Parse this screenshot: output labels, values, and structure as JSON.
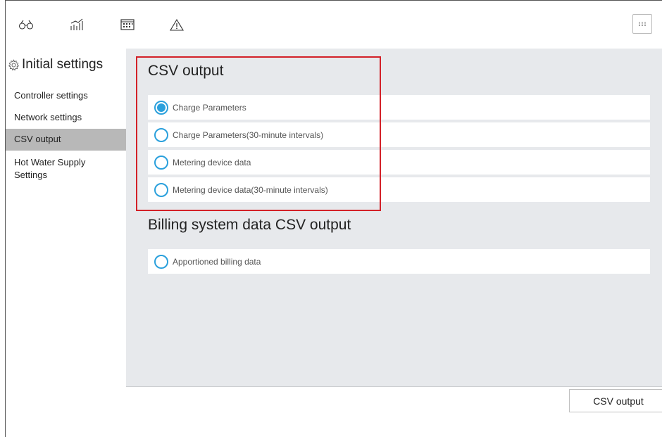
{
  "toolbar": {
    "icons": [
      "binoculars-icon",
      "chart-icon",
      "calendar-icon",
      "warning-icon"
    ],
    "menu_icon": "menu-icon"
  },
  "sidebar": {
    "title": "Initial settings",
    "title_icon": "gear-icon",
    "items": [
      {
        "label": "Controller settings",
        "active": false
      },
      {
        "label": "Network settings",
        "active": false
      },
      {
        "label": "CSV output",
        "active": true
      },
      {
        "label": "Hot Water Supply Settings",
        "active": false
      }
    ]
  },
  "main": {
    "csv_section": {
      "title": "CSV output",
      "options": [
        {
          "label": "Charge Parameters",
          "selected": true
        },
        {
          "label": "Charge Parameters(30-minute intervals)",
          "selected": false
        },
        {
          "label": "Metering device data",
          "selected": false
        },
        {
          "label": "Metering device data(30-minute intervals)",
          "selected": false
        }
      ]
    },
    "billing_section": {
      "title": "Billing system data CSV output",
      "options": [
        {
          "label": "Apportioned billing data",
          "selected": false
        }
      ]
    }
  },
  "footer": {
    "button_label": "CSV output"
  },
  "colors": {
    "accent": "#2aa0dc",
    "highlight": "#d32128",
    "panel": "#e7e9ec",
    "active_item": "#b8b8b8"
  }
}
